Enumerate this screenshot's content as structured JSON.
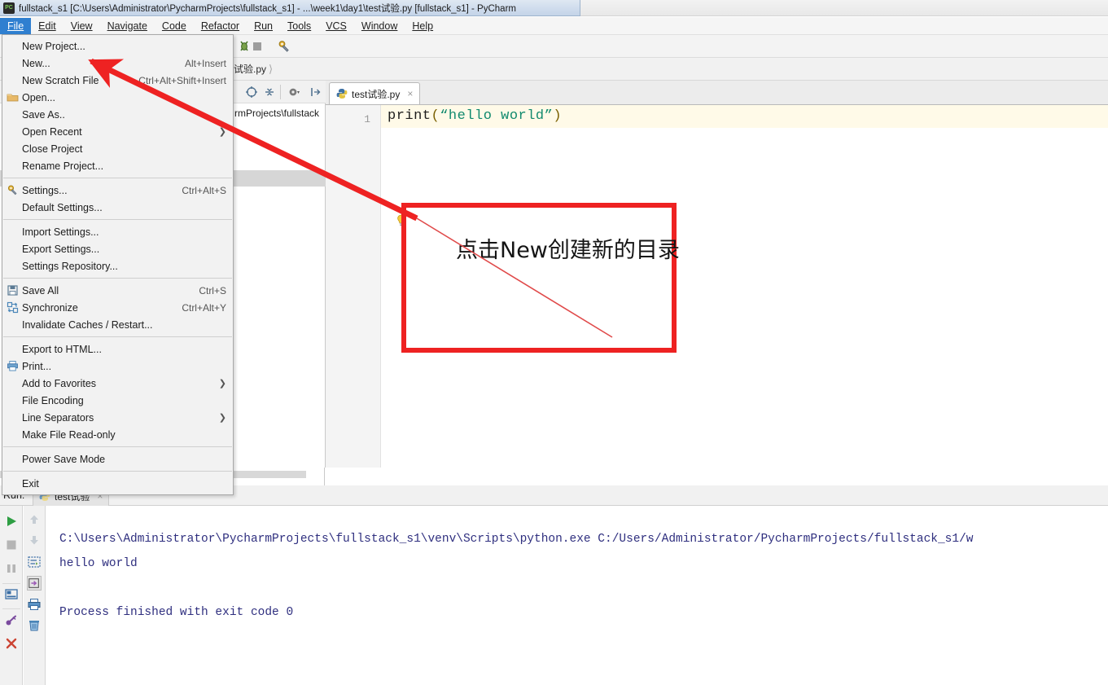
{
  "window": {
    "title": "fullstack_s1 [C:\\Users\\Administrator\\PycharmProjects\\fullstack_s1] - ...\\week1\\day1\\test试验.py [fullstack_s1] - PyCharm",
    "app_icon": "pycharm-icon"
  },
  "menubar": {
    "items": [
      {
        "label": "File",
        "active": true
      },
      {
        "label": "Edit",
        "active": false
      },
      {
        "label": "View",
        "active": false
      },
      {
        "label": "Navigate",
        "active": false
      },
      {
        "label": "Code",
        "active": false
      },
      {
        "label": "Refactor",
        "active": false
      },
      {
        "label": "Run",
        "active": false
      },
      {
        "label": "Tools",
        "active": false
      },
      {
        "label": "VCS",
        "active": false
      },
      {
        "label": "Window",
        "active": false
      },
      {
        "label": "Help",
        "active": false
      }
    ]
  },
  "file_menu": {
    "groups": [
      {
        "items": [
          {
            "label": "New Project...",
            "shortcut": "",
            "icon": "",
            "submenu": false
          },
          {
            "label": "New...",
            "shortcut": "Alt+Insert",
            "icon": "",
            "submenu": false
          },
          {
            "label": "New Scratch File",
            "shortcut": "Ctrl+Alt+Shift+Insert",
            "icon": "",
            "submenu": false
          },
          {
            "label": "Open...",
            "shortcut": "",
            "icon": "folder-icon",
            "submenu": false
          },
          {
            "label": "Save As..",
            "shortcut": "",
            "icon": "",
            "submenu": false
          },
          {
            "label": "Open Recent",
            "shortcut": "",
            "icon": "",
            "submenu": true
          },
          {
            "label": "Close Project",
            "shortcut": "",
            "icon": "",
            "submenu": false
          },
          {
            "label": "Rename Project...",
            "shortcut": "",
            "icon": "",
            "submenu": false
          }
        ]
      },
      {
        "items": [
          {
            "label": "Settings...",
            "shortcut": "Ctrl+Alt+S",
            "icon": "gear-wrench-icon",
            "submenu": false
          },
          {
            "label": "Default Settings...",
            "shortcut": "",
            "icon": "",
            "submenu": false
          }
        ]
      },
      {
        "items": [
          {
            "label": "Import Settings...",
            "shortcut": "",
            "icon": "",
            "submenu": false
          },
          {
            "label": "Export Settings...",
            "shortcut": "",
            "icon": "",
            "submenu": false
          },
          {
            "label": "Settings Repository...",
            "shortcut": "",
            "icon": "",
            "submenu": false
          }
        ]
      },
      {
        "items": [
          {
            "label": "Save All",
            "shortcut": "Ctrl+S",
            "icon": "save-icon",
            "submenu": false
          },
          {
            "label": "Synchronize",
            "shortcut": "Ctrl+Alt+Y",
            "icon": "sync-icon",
            "submenu": false
          },
          {
            "label": "Invalidate Caches / Restart...",
            "shortcut": "",
            "icon": "",
            "submenu": false
          }
        ]
      },
      {
        "items": [
          {
            "label": "Export to HTML...",
            "shortcut": "",
            "icon": "",
            "submenu": false
          },
          {
            "label": "Print...",
            "shortcut": "",
            "icon": "printer-icon",
            "submenu": false
          },
          {
            "label": "Add to Favorites",
            "shortcut": "",
            "icon": "",
            "submenu": true
          },
          {
            "label": "File Encoding",
            "shortcut": "",
            "icon": "",
            "submenu": false
          },
          {
            "label": "Line Separators",
            "shortcut": "",
            "icon": "",
            "submenu": true
          },
          {
            "label": "Make File Read-only",
            "shortcut": "",
            "icon": "",
            "submenu": false
          }
        ]
      },
      {
        "items": [
          {
            "label": "Power Save Mode",
            "shortcut": "",
            "icon": "",
            "submenu": false
          }
        ]
      },
      {
        "items": [
          {
            "label": "Exit",
            "shortcut": "",
            "icon": "",
            "submenu": false
          }
        ]
      }
    ]
  },
  "breadcrumb": {
    "text": "试验.py"
  },
  "project": {
    "visible_node": "rmProjects\\fullstack"
  },
  "editor": {
    "tab": {
      "label": "test试验.py",
      "icon": "python-file-icon",
      "close": "×"
    },
    "line_numbers": [
      "1"
    ],
    "code": {
      "fn": "print",
      "open_paren": "(",
      "string": "“hello world”",
      "close_paren": ")"
    },
    "intention_bulb": "lightbulb-icon"
  },
  "annotation": {
    "text": "点击New创建新的目录",
    "box_color": "#ee2222",
    "arrow_color": "#ee2222"
  },
  "run_panel": {
    "label": "Run:",
    "tab_label": "test试验",
    "tab_icon": "python-file-icon",
    "tab_close": "×",
    "left_toolbar": [
      {
        "name": "rerun-icon",
        "glyph": "▶"
      },
      {
        "name": "stop-icon",
        "glyph": "■"
      },
      {
        "name": "pause-icon",
        "glyph": "‖"
      },
      {
        "name": "show-console-icon",
        "glyph": "▤"
      },
      {
        "name": "attach-debugger-icon",
        "glyph": "⚒"
      },
      {
        "name": "close-tab-icon",
        "glyph": "✕"
      }
    ],
    "right_toolbar": [
      {
        "name": "up-arrow-icon",
        "glyph": "↑"
      },
      {
        "name": "down-arrow-icon",
        "glyph": "↓"
      },
      {
        "name": "soft-wrap-icon",
        "glyph": "↵"
      },
      {
        "name": "scroll-to-end-icon",
        "glyph": "⇥"
      },
      {
        "name": "print-icon",
        "glyph": "⎙"
      },
      {
        "name": "clear-all-icon",
        "glyph": "Ὕ1"
      }
    ],
    "console_lines": [
      "C:\\Users\\Administrator\\PycharmProjects\\fullstack_s1\\venv\\Scripts\\python.exe C:/Users/Administrator/PycharmProjects/fullstack_s1/w",
      "hello world",
      "",
      "Process finished with exit code 0"
    ]
  }
}
